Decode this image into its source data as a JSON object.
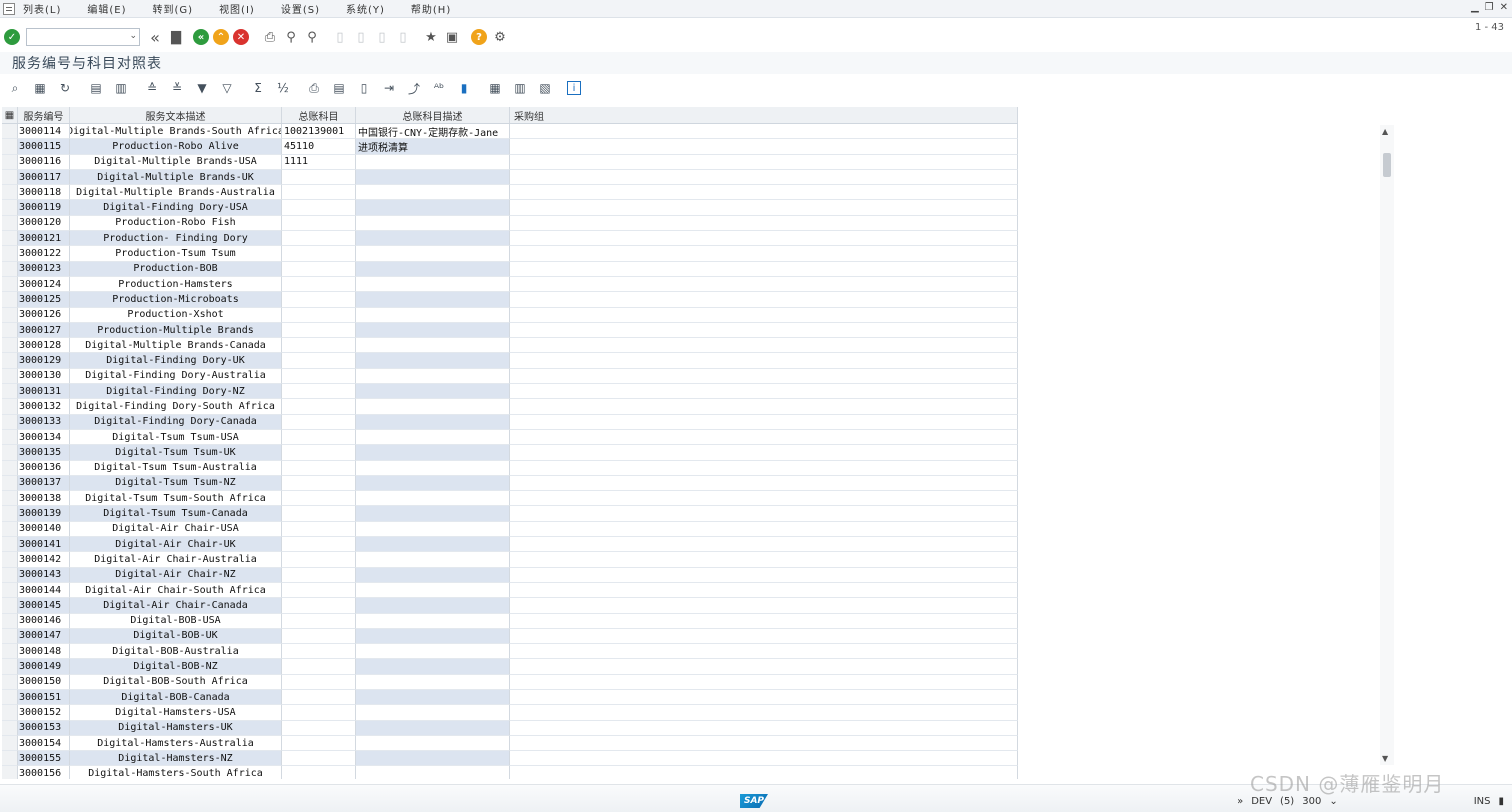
{
  "menu": {
    "items": [
      "列表(L)",
      "编辑(E)",
      "转到(G)",
      "视图(I)",
      "设置(S)",
      "系统(Y)",
      "帮助(H)"
    ]
  },
  "toolbar": {
    "command_value": "",
    "page_info": "1 - 43"
  },
  "page_title": "服务编号与科目对照表",
  "columns": [
    "服务编号",
    "服务文本描述",
    "总账科目",
    "总账科目描述",
    "采购组"
  ],
  "rows": [
    {
      "id": "3000114",
      "desc": "Digital-Multiple Brands-South Africa",
      "gl": "1002139001",
      "gl_desc": "中国银行-CNY-定期存款-Jane",
      "pg": ""
    },
    {
      "id": "3000115",
      "desc": "Production-Robo Alive",
      "gl": "45110",
      "gl_desc": "进项税清算",
      "pg": ""
    },
    {
      "id": "3000116",
      "desc": "Digital-Multiple Brands-USA",
      "gl": "1111",
      "gl_desc": "",
      "pg": ""
    },
    {
      "id": "3000117",
      "desc": "Digital-Multiple Brands-UK",
      "gl": "",
      "gl_desc": "",
      "pg": ""
    },
    {
      "id": "3000118",
      "desc": "Digital-Multiple Brands-Australia",
      "gl": "",
      "gl_desc": "",
      "pg": ""
    },
    {
      "id": "3000119",
      "desc": "Digital-Finding Dory-USA",
      "gl": "",
      "gl_desc": "",
      "pg": ""
    },
    {
      "id": "3000120",
      "desc": "Production-Robo Fish",
      "gl": "",
      "gl_desc": "",
      "pg": ""
    },
    {
      "id": "3000121",
      "desc": "Production- Finding Dory",
      "gl": "",
      "gl_desc": "",
      "pg": ""
    },
    {
      "id": "3000122",
      "desc": "Production-Tsum Tsum",
      "gl": "",
      "gl_desc": "",
      "pg": ""
    },
    {
      "id": "3000123",
      "desc": "Production-BOB",
      "gl": "",
      "gl_desc": "",
      "pg": ""
    },
    {
      "id": "3000124",
      "desc": "Production-Hamsters",
      "gl": "",
      "gl_desc": "",
      "pg": ""
    },
    {
      "id": "3000125",
      "desc": "Production-Microboats",
      "gl": "",
      "gl_desc": "",
      "pg": ""
    },
    {
      "id": "3000126",
      "desc": "Production-Xshot",
      "gl": "",
      "gl_desc": "",
      "pg": ""
    },
    {
      "id": "3000127",
      "desc": "Production-Multiple Brands",
      "gl": "",
      "gl_desc": "",
      "pg": ""
    },
    {
      "id": "3000128",
      "desc": "Digital-Multiple Brands-Canada",
      "gl": "",
      "gl_desc": "",
      "pg": ""
    },
    {
      "id": "3000129",
      "desc": "Digital-Finding Dory-UK",
      "gl": "",
      "gl_desc": "",
      "pg": ""
    },
    {
      "id": "3000130",
      "desc": "Digital-Finding Dory-Australia",
      "gl": "",
      "gl_desc": "",
      "pg": ""
    },
    {
      "id": "3000131",
      "desc": "Digital-Finding Dory-NZ",
      "gl": "",
      "gl_desc": "",
      "pg": ""
    },
    {
      "id": "3000132",
      "desc": "Digital-Finding Dory-South Africa",
      "gl": "",
      "gl_desc": "",
      "pg": ""
    },
    {
      "id": "3000133",
      "desc": "Digital-Finding Dory-Canada",
      "gl": "",
      "gl_desc": "",
      "pg": ""
    },
    {
      "id": "3000134",
      "desc": "Digital-Tsum Tsum-USA",
      "gl": "",
      "gl_desc": "",
      "pg": ""
    },
    {
      "id": "3000135",
      "desc": "Digital-Tsum Tsum-UK",
      "gl": "",
      "gl_desc": "",
      "pg": ""
    },
    {
      "id": "3000136",
      "desc": "Digital-Tsum Tsum-Australia",
      "gl": "",
      "gl_desc": "",
      "pg": ""
    },
    {
      "id": "3000137",
      "desc": "Digital-Tsum Tsum-NZ",
      "gl": "",
      "gl_desc": "",
      "pg": ""
    },
    {
      "id": "3000138",
      "desc": "Digital-Tsum Tsum-South Africa",
      "gl": "",
      "gl_desc": "",
      "pg": ""
    },
    {
      "id": "3000139",
      "desc": "Digital-Tsum Tsum-Canada",
      "gl": "",
      "gl_desc": "",
      "pg": ""
    },
    {
      "id": "3000140",
      "desc": "Digital-Air Chair-USA",
      "gl": "",
      "gl_desc": "",
      "pg": ""
    },
    {
      "id": "3000141",
      "desc": "Digital-Air Chair-UK",
      "gl": "",
      "gl_desc": "",
      "pg": ""
    },
    {
      "id": "3000142",
      "desc": "Digital-Air Chair-Australia",
      "gl": "",
      "gl_desc": "",
      "pg": ""
    },
    {
      "id": "3000143",
      "desc": "Digital-Air Chair-NZ",
      "gl": "",
      "gl_desc": "",
      "pg": ""
    },
    {
      "id": "3000144",
      "desc": "Digital-Air Chair-South Africa",
      "gl": "",
      "gl_desc": "",
      "pg": ""
    },
    {
      "id": "3000145",
      "desc": "Digital-Air Chair-Canada",
      "gl": "",
      "gl_desc": "",
      "pg": ""
    },
    {
      "id": "3000146",
      "desc": "Digital-BOB-USA",
      "gl": "",
      "gl_desc": "",
      "pg": ""
    },
    {
      "id": "3000147",
      "desc": "Digital-BOB-UK",
      "gl": "",
      "gl_desc": "",
      "pg": ""
    },
    {
      "id": "3000148",
      "desc": "Digital-BOB-Australia",
      "gl": "",
      "gl_desc": "",
      "pg": ""
    },
    {
      "id": "3000149",
      "desc": "Digital-BOB-NZ",
      "gl": "",
      "gl_desc": "",
      "pg": ""
    },
    {
      "id": "3000150",
      "desc": "Digital-BOB-South Africa",
      "gl": "",
      "gl_desc": "",
      "pg": ""
    },
    {
      "id": "3000151",
      "desc": "Digital-BOB-Canada",
      "gl": "",
      "gl_desc": "",
      "pg": ""
    },
    {
      "id": "3000152",
      "desc": "Digital-Hamsters-USA",
      "gl": "",
      "gl_desc": "",
      "pg": ""
    },
    {
      "id": "3000153",
      "desc": "Digital-Hamsters-UK",
      "gl": "",
      "gl_desc": "",
      "pg": ""
    },
    {
      "id": "3000154",
      "desc": "Digital-Hamsters-Australia",
      "gl": "",
      "gl_desc": "",
      "pg": ""
    },
    {
      "id": "3000155",
      "desc": "Digital-Hamsters-NZ",
      "gl": "",
      "gl_desc": "",
      "pg": ""
    },
    {
      "id": "3000156",
      "desc": "Digital-Hamsters-South Africa",
      "gl": "",
      "gl_desc": "",
      "pg": ""
    }
  ],
  "status": {
    "system": "DEV",
    "session": "(5)",
    "client": "300",
    "mode": "INS",
    "logo": "SAP"
  },
  "watermark": "CSDN @薄雁鉴明月",
  "colors": {
    "alt_row": "#dce4f0",
    "ok": "#2e9b3e",
    "back": "#2e9b3e",
    "up": "#f0a31a",
    "cancel": "#d9332f",
    "help": "#f0a31a"
  }
}
